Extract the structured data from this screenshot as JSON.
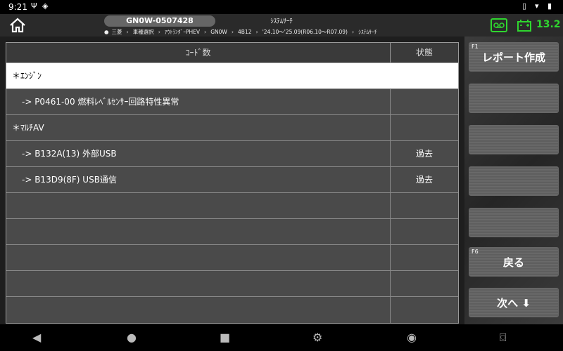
{
  "status_bar": {
    "time": "9:21",
    "left_icons": [
      "usb-icon",
      "location-icon"
    ],
    "right_icons": [
      "vibrate-icon",
      "wifi-icon",
      "battery-icon"
    ]
  },
  "header": {
    "vin": "GN0W-0507428",
    "title": "ｼｽﾃﾑｻｰﾁ",
    "breadcrumb": [
      "三菱",
      "車種選択",
      "ｱｳﾄﾗﾝﾀﾞｰPHEV",
      "GN0W",
      "4B12",
      "'24.10〜'25.09(R06.10〜R07.09)",
      "ｼｽﾃﾑｻｰﾁ"
    ],
    "voltage": "13.2",
    "accent_color": "#2fd62f"
  },
  "table": {
    "headers": [
      "ｺｰﾄﾞ数",
      "状態"
    ],
    "rows": [
      {
        "code": "＊ｴﾝｼﾞﾝ",
        "status": "",
        "type": "group",
        "selected": true
      },
      {
        "code": "->   P0461-00 燃料ﾚﾍﾞﾙｾﾝｻｰ回路特性異常",
        "status": "",
        "type": "item"
      },
      {
        "code": "＊ﾏﾙﾁAV",
        "status": "",
        "type": "group"
      },
      {
        "code": "->   B132A(13) 外部USB",
        "status": "過去",
        "type": "item"
      },
      {
        "code": "->   B13D9(8F) USB通信",
        "status": "過去",
        "type": "item"
      },
      {
        "code": "",
        "status": "",
        "type": "empty"
      },
      {
        "code": "",
        "status": "",
        "type": "empty"
      },
      {
        "code": "",
        "status": "",
        "type": "empty"
      },
      {
        "code": "",
        "status": "",
        "type": "empty"
      },
      {
        "code": "",
        "status": "",
        "type": "empty"
      }
    ]
  },
  "function_keys": [
    {
      "key": "F1",
      "label": "レポート作成"
    },
    {
      "key": "",
      "label": ""
    },
    {
      "key": "",
      "label": ""
    },
    {
      "key": "",
      "label": ""
    },
    {
      "key": "",
      "label": ""
    },
    {
      "key": "F6",
      "label": "戻る"
    },
    {
      "key": "",
      "label": "次へ ⬇"
    }
  ],
  "nav_bar": [
    "back-icon",
    "home-icon",
    "recents-icon",
    "settings-icon",
    "chrome-icon",
    "screenshot-icon"
  ]
}
